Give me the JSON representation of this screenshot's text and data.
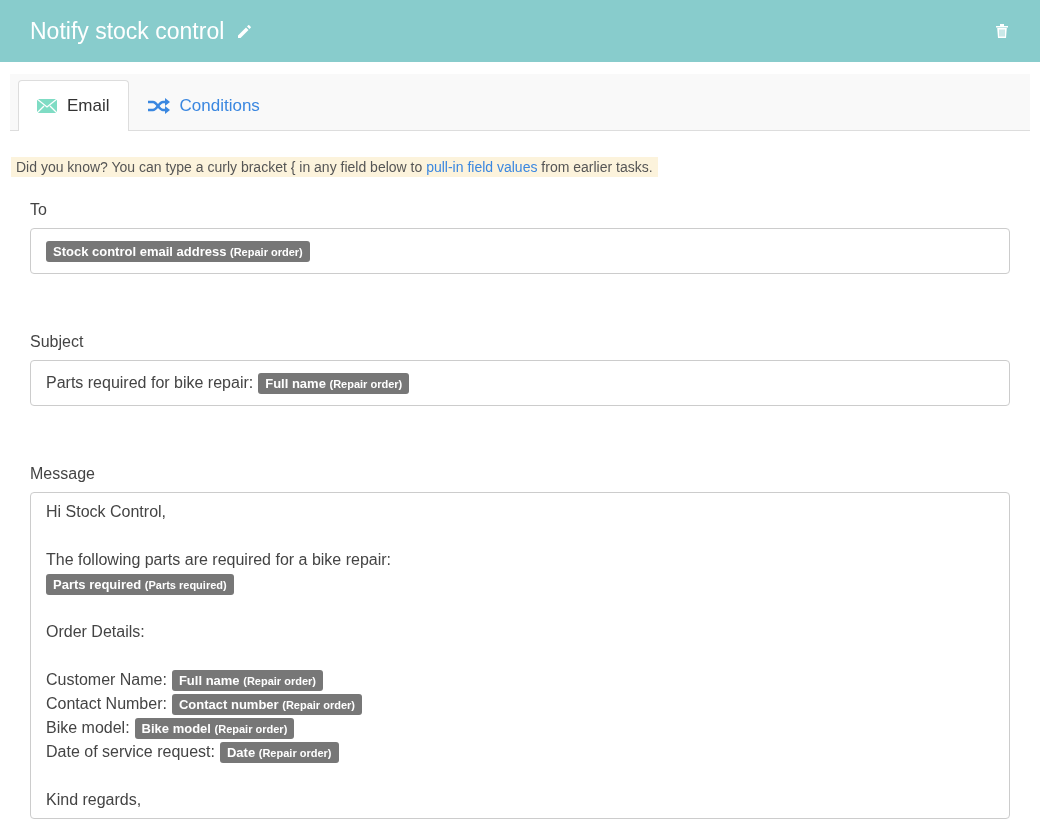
{
  "header": {
    "title": "Notify stock control"
  },
  "tabs": [
    {
      "label": "Email",
      "kind": "envelope",
      "selected": true
    },
    {
      "label": "Conditions",
      "kind": "shuffle",
      "selected": false
    }
  ],
  "tip": {
    "before": "Did you know? You can type a curly bracket { in any field below to",
    "link": "pull-in field values",
    "after": "from earlier tasks."
  },
  "fields": [
    {
      "label": "To",
      "kind": "single",
      "lines": [
        {
          "kind": "content",
          "segments": [
            {
              "kind": "token",
              "name": "Stock control email address",
              "source": "(Repair order)"
            }
          ]
        }
      ]
    },
    {
      "label": "Subject",
      "kind": "single",
      "lines": [
        {
          "kind": "content",
          "segments": [
            {
              "kind": "text",
              "text": "Parts required for bike repair:"
            },
            {
              "kind": "token",
              "name": "Full name",
              "source": "(Repair order)"
            }
          ]
        }
      ]
    },
    {
      "label": "Message",
      "kind": "multi",
      "lines": [
        {
          "kind": "content",
          "segments": [
            {
              "kind": "text",
              "text": "Hi Stock Control,"
            }
          ]
        },
        {
          "kind": "blank"
        },
        {
          "kind": "content",
          "segments": [
            {
              "kind": "text",
              "text": "The following parts are required for a bike repair:"
            }
          ]
        },
        {
          "kind": "content",
          "segments": [
            {
              "kind": "token",
              "name": "Parts required",
              "source": "(Parts required)"
            }
          ]
        },
        {
          "kind": "blank"
        },
        {
          "kind": "content",
          "segments": [
            {
              "kind": "text",
              "text": "Order Details:"
            }
          ]
        },
        {
          "kind": "blank"
        },
        {
          "kind": "content",
          "segments": [
            {
              "kind": "text",
              "text": "Customer Name:"
            },
            {
              "kind": "token",
              "name": "Full name",
              "source": "(Repair order)"
            }
          ]
        },
        {
          "kind": "content",
          "segments": [
            {
              "kind": "text",
              "text": "Contact Number:"
            },
            {
              "kind": "token",
              "name": "Contact number",
              "source": "(Repair order)"
            }
          ]
        },
        {
          "kind": "content",
          "segments": [
            {
              "kind": "text",
              "text": "Bike model:"
            },
            {
              "kind": "token",
              "name": "Bike model",
              "source": "(Repair order)"
            }
          ]
        },
        {
          "kind": "content",
          "segments": [
            {
              "kind": "text",
              "text": "Date of service request:"
            },
            {
              "kind": "token",
              "name": "Date",
              "source": "(Repair order)"
            }
          ]
        },
        {
          "kind": "blank"
        },
        {
          "kind": "content",
          "segments": [
            {
              "kind": "text",
              "text": "Kind regards,"
            }
          ]
        }
      ]
    }
  ]
}
